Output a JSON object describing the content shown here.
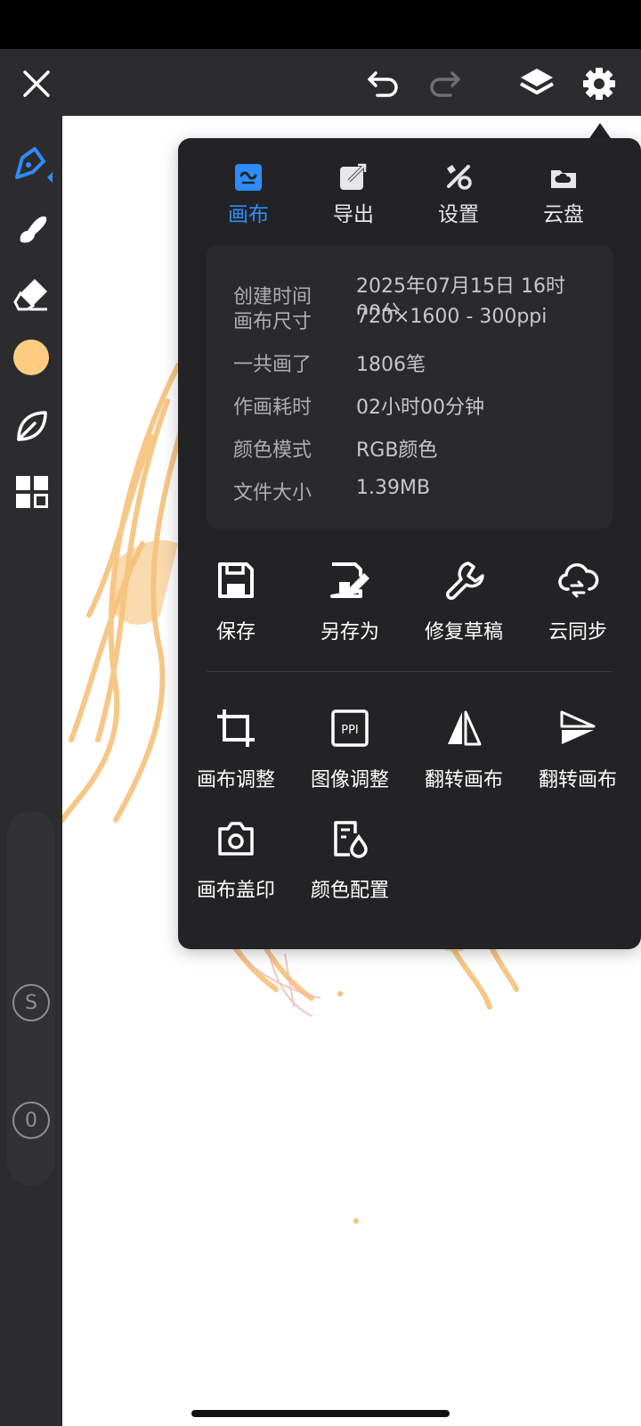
{
  "panel": {
    "tabs": [
      {
        "label": "画布",
        "icon": "canvas-icon",
        "active": true
      },
      {
        "label": "导出",
        "icon": "export-icon",
        "active": false
      },
      {
        "label": "设置",
        "icon": "settings-tools-icon",
        "active": false
      },
      {
        "label": "云盘",
        "icon": "cloud-drive-icon",
        "active": false
      }
    ],
    "info": [
      {
        "key": "创建时间",
        "value": "2025年07月15日 16时00分"
      },
      {
        "key": "画布尺寸",
        "value": "720×1600 - 300ppi"
      },
      {
        "key": "一共画了",
        "value": "1806笔"
      },
      {
        "key": "作画耗时",
        "value": "02小时00分钟"
      },
      {
        "key": "颜色模式",
        "value": "RGB颜色"
      },
      {
        "key": "文件大小",
        "value": "1.39MB"
      }
    ],
    "actions_row1": [
      {
        "label": "保存",
        "icon": "save-icon"
      },
      {
        "label": "另存为",
        "icon": "save-as-icon"
      },
      {
        "label": "修复草稿",
        "icon": "repair-wrench-icon"
      },
      {
        "label": "云同步",
        "icon": "cloud-sync-icon"
      }
    ],
    "actions_row2": [
      {
        "label": "画布调整",
        "icon": "crop-icon"
      },
      {
        "label": "图像调整",
        "icon": "ppi-icon"
      },
      {
        "label": "翻转画布",
        "icon": "flip-horizontal-icon"
      },
      {
        "label": "翻转画布",
        "icon": "flip-vertical-icon"
      }
    ],
    "actions_row3": [
      {
        "label": "画布盖印",
        "icon": "camera-icon"
      },
      {
        "label": "颜色配置",
        "icon": "color-config-icon"
      }
    ]
  },
  "sidebar": {
    "tools": [
      "pen-tool-icon",
      "smudge-brush-icon",
      "eraser-icon",
      "color-swatch",
      "leaf-icon",
      "grid-icon"
    ],
    "current_color": "#ffcc80",
    "slider_size_label": "S",
    "slider_opacity_label": "0"
  },
  "toolbar": {
    "icons": [
      "close-icon",
      "undo-icon",
      "redo-icon",
      "layers-icon",
      "settings-gear-icon"
    ]
  },
  "colors": {
    "accent": "#2f8cff",
    "background_dark": "#2c2c2e",
    "panel": "#232325",
    "sketch": "#f6c27a"
  }
}
